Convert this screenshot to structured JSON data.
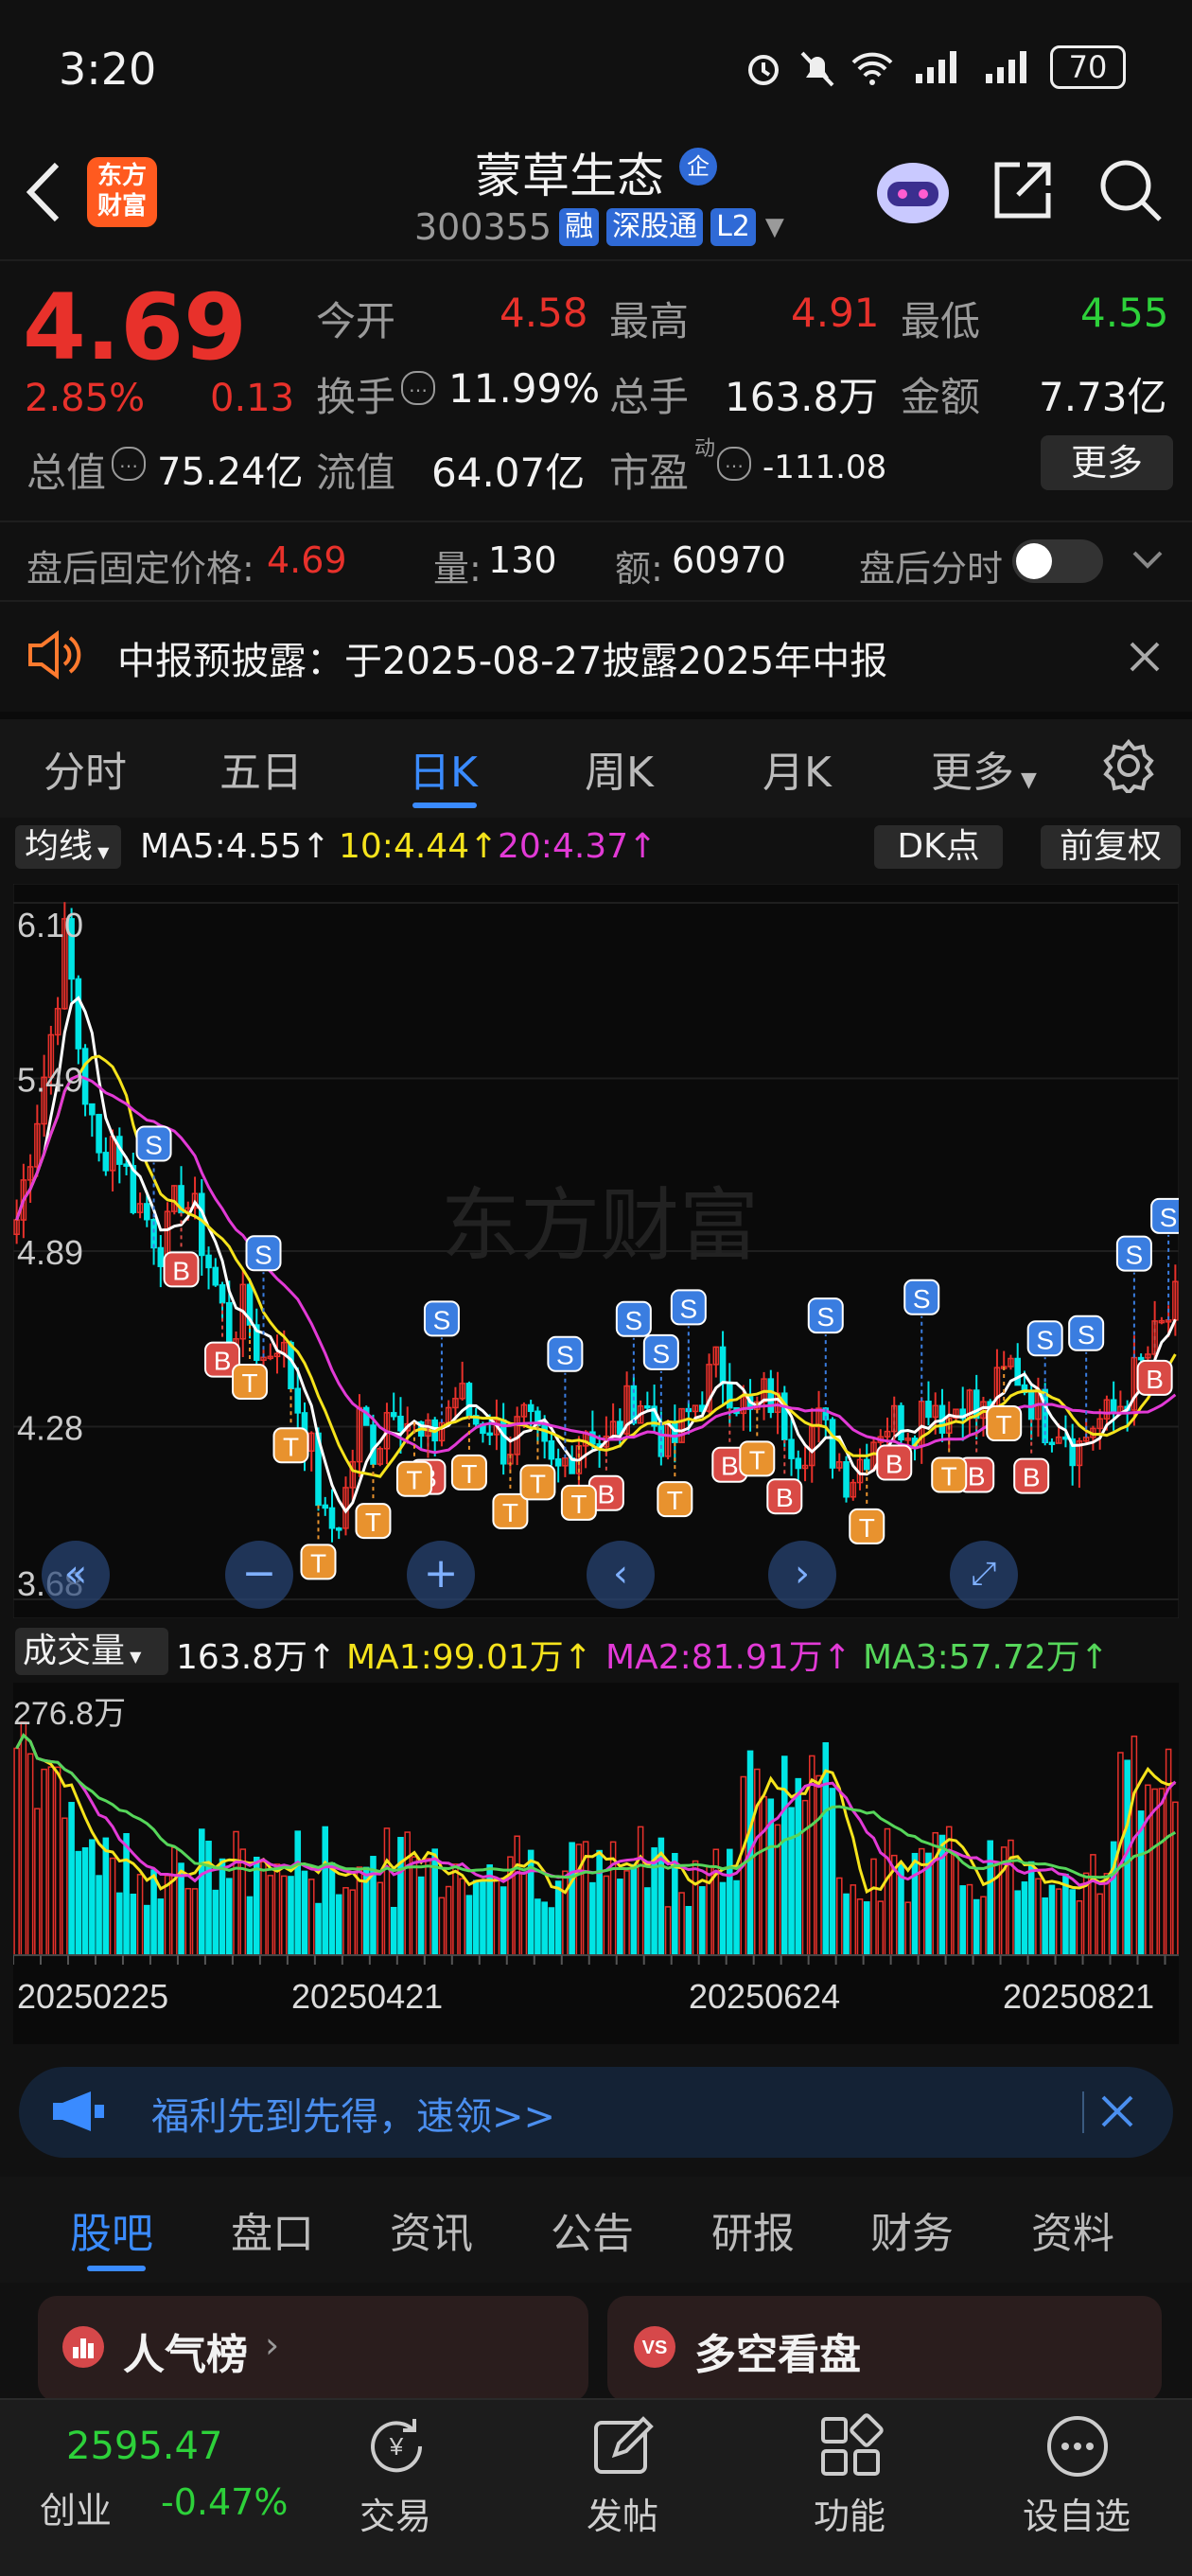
{
  "status_bar": {
    "time": "3:20",
    "battery": "70"
  },
  "header": {
    "logo_text": "东方\n财富",
    "stock_name": "蒙草生态",
    "stock_badge": "企",
    "stock_code": "300355",
    "tags": [
      "融",
      "深股通",
      "L2"
    ]
  },
  "quote": {
    "price": "4.69",
    "change_pct": "2.85%",
    "change": "0.13",
    "open_label": "今开",
    "open": "4.58",
    "high_label": "最高",
    "high": "4.91",
    "low_label": "最低",
    "low": "4.55",
    "turnover_label": "换手",
    "turnover": "11.99%",
    "volume_label": "总手",
    "volume": "163.8万",
    "amount_label": "金额",
    "amount": "7.73亿",
    "mktcap_label": "总值",
    "mktcap": "75.24亿",
    "float_label": "流值",
    "float": "64.07亿",
    "pe_label": "市盈",
    "pe_sup": "动",
    "pe": "-111.08",
    "more": "更多"
  },
  "after_hours": {
    "label": "盘后固定价格:",
    "price": "4.69",
    "vol_label": "量:",
    "vol": "130",
    "amt_label": "额:",
    "amt": "60970",
    "timeshare_label": "盘后分时"
  },
  "notice": {
    "text": "中报预披露：于2025-08-27披露2025年中报"
  },
  "chart_tabs": [
    "分时",
    "五日",
    "日K",
    "周K",
    "月K",
    "更多"
  ],
  "chart_tabs_active": 2,
  "ma_bar": {
    "selector": "均线",
    "ma5": "MA5:4.55",
    "ma10": "10:4.44",
    "ma20": "20:4.37",
    "dk": "DK点",
    "adjust": "前复权"
  },
  "price_axis": [
    "6.10",
    "5.49",
    "4.89",
    "4.28",
    "3.68"
  ],
  "watermark": "东方财富",
  "volume_bar": {
    "selector": "成交量",
    "vol": "163.8万",
    "ma1": "MA1:99.01万",
    "ma2": "MA2:81.91万",
    "ma3": "MA3:57.72万",
    "axis_top": "276.8万"
  },
  "date_axis": [
    "20250225",
    "20250421",
    "20250624",
    "20250821"
  ],
  "promo": {
    "text": "福利先到先得，速领>>"
  },
  "section_tabs": [
    "股吧",
    "盘口",
    "资讯",
    "公告",
    "研报",
    "财务",
    "资料"
  ],
  "section_tabs_active": 0,
  "cards": [
    {
      "title": "人气榜"
    },
    {
      "title": "多空看盘"
    }
  ],
  "bottom_nav": {
    "index_value": "2595.47",
    "index_name": "创业",
    "index_change": "-0.47%",
    "items": [
      "交易",
      "发帖",
      "功能",
      "设自选"
    ]
  },
  "colors": {
    "up": "#e8312b",
    "down": "#00e5e5",
    "accent": "#3a8bff",
    "ma5": "#ffffff",
    "ma10": "#f5e31c",
    "ma20": "#e23ad6",
    "ma3": "#56d65a"
  },
  "chart_data": {
    "type": "candlestick",
    "y_range": [
      3.68,
      6.1
    ],
    "x_start": "20250225",
    "x_end": "20250821",
    "close_trend": [
      5.0,
      5.3,
      5.6,
      6.0,
      5.5,
      5.2,
      5.3,
      5.1,
      5.0,
      4.9,
      5.1,
      5.0,
      4.8,
      4.6,
      4.7,
      4.5,
      4.6,
      4.4,
      4.2,
      3.9,
      4.0,
      4.3,
      4.2,
      4.4,
      4.3,
      4.2,
      4.3,
      4.4,
      4.3,
      4.3,
      4.2,
      4.3,
      4.2,
      4.1,
      4.2,
      4.3,
      4.2,
      4.3,
      4.4,
      4.3,
      4.2,
      4.3,
      4.4,
      4.5,
      4.4,
      4.3,
      4.4,
      4.3,
      4.2,
      4.3,
      4.2,
      4.1,
      4.2,
      4.3,
      4.3,
      4.3,
      4.4,
      4.3,
      4.4,
      4.3,
      4.4,
      4.5,
      4.4,
      4.3,
      4.3,
      4.2,
      4.3,
      4.3,
      4.4,
      4.5,
      4.6,
      4.7
    ]
  }
}
